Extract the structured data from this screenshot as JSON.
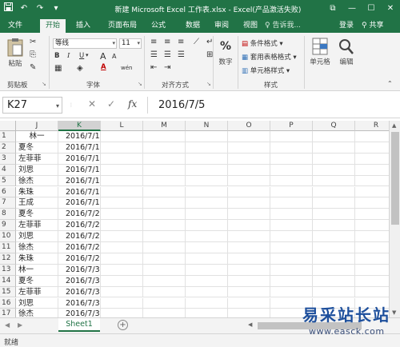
{
  "window": {
    "title": "新建 Microsoft Excel 工作表.xlsx - Excel(产品激活失败)",
    "controls": {
      "restore": "⧉",
      "minimize": "—",
      "maximize": "☐",
      "close": "✕"
    }
  },
  "quick_access": {
    "save_icon": "save-icon",
    "undo_icon": "undo-icon",
    "redo_icon": "redo-icon",
    "customize_icon": "chevron-down-icon"
  },
  "tabs": [
    "文件",
    "开始",
    "插入",
    "页面布局",
    "公式",
    "数据",
    "审阅",
    "视图"
  ],
  "active_tab": "开始",
  "tell_me": "♀ 告诉我...",
  "login": "登录",
  "share": "共享",
  "ribbon": {
    "clipboard": {
      "paste": "粘贴",
      "label": "剪贴板"
    },
    "font": {
      "name": "等线",
      "size": "11",
      "label": "字体",
      "grow": "A",
      "shrink": "A",
      "wen": "wén"
    },
    "alignment": {
      "label": "对齐方式"
    },
    "number": {
      "button": "数字",
      "symbol": "%"
    },
    "styles": {
      "label": "样式",
      "conditional": "条件格式 ▾",
      "table": "套用表格格式 ▾",
      "cell_styles": "单元格样式 ▾"
    },
    "cells": {
      "button": "单元格"
    },
    "editing": {
      "button": "编辑"
    }
  },
  "formula_bar": {
    "name_box": "K27",
    "cancel": "✕",
    "enter": "✓",
    "fx": "fx",
    "value": "2016/7/5"
  },
  "grid": {
    "columns": [
      "J",
      "K",
      "L",
      "M",
      "N",
      "O",
      "P",
      "Q",
      "R"
    ],
    "rows": [
      {
        "n": "1",
        "j": "林一",
        "k": "2016/7/1"
      },
      {
        "n": "2",
        "j": "夏冬",
        "k": "2016/7/1"
      },
      {
        "n": "3",
        "j": "左菲菲",
        "k": "2016/7/1"
      },
      {
        "n": "4",
        "j": "刘思",
        "k": "2016/7/1"
      },
      {
        "n": "5",
        "j": "徐杰",
        "k": "2016/7/1"
      },
      {
        "n": "6",
        "j": "朱珠",
        "k": "2016/7/1"
      },
      {
        "n": "7",
        "j": "王成",
        "k": "2016/7/1"
      },
      {
        "n": "8",
        "j": "夏冬",
        "k": "2016/7/2"
      },
      {
        "n": "9",
        "j": "左菲菲",
        "k": "2016/7/2"
      },
      {
        "n": "10",
        "j": "刘思",
        "k": "2016/7/2"
      },
      {
        "n": "11",
        "j": "徐杰",
        "k": "2016/7/2"
      },
      {
        "n": "12",
        "j": "朱珠",
        "k": "2016/7/2"
      },
      {
        "n": "13",
        "j": "林一",
        "k": "2016/7/3"
      },
      {
        "n": "14",
        "j": "夏冬",
        "k": "2016/7/3"
      },
      {
        "n": "15",
        "j": "左菲菲",
        "k": "2016/7/3"
      },
      {
        "n": "16",
        "j": "刘思",
        "k": "2016/7/3"
      },
      {
        "n": "17",
        "j": "徐杰",
        "k": "2016/7/3"
      }
    ]
  },
  "sheet_tabs": [
    "Sheet1"
  ],
  "add_sheet": "+",
  "status": "就绪",
  "watermark": {
    "text": "易采站长站",
    "url": "www.easck.com"
  },
  "colors": {
    "brand": "#217346",
    "watermark": "#1d4f9c"
  }
}
